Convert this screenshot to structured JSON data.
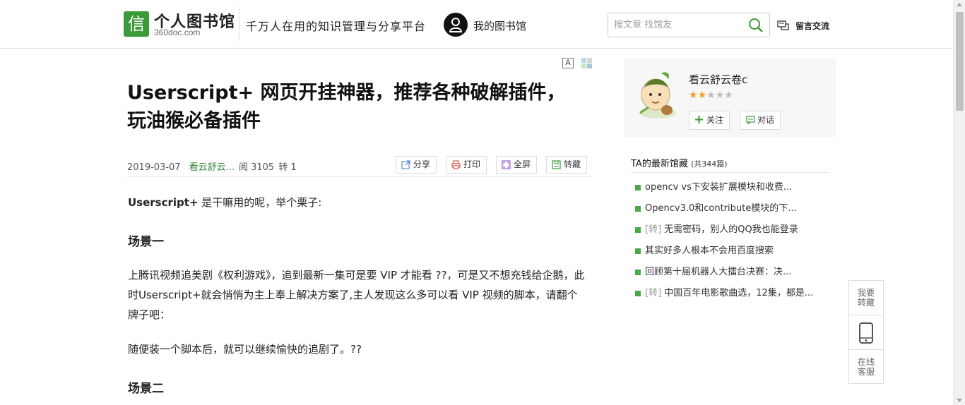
{
  "header": {
    "logo_glyph": "信",
    "logo_name": "个人图书馆",
    "logo_domain": "360doc.com",
    "slogan": "千万人在用的知识管理与分享平台",
    "my_library": "我的图书馆",
    "search_placeholder": "搜文章 找馆友",
    "message_label": "留言交流"
  },
  "article": {
    "font_toggle": "A",
    "title": "Userscript+ 网页开挂神器，推荐各种破解插件，玩油猴必备插件",
    "date": "2019-03-07",
    "author": "看云舒云...",
    "reads": "阅 3105",
    "reposts": "转 1",
    "actions": {
      "share": "分享",
      "print": "打印",
      "fullscreen": "全屏",
      "save": "转藏"
    },
    "intro_bold": "Userscript+",
    "intro_rest": " 是干嘛用的呢，举个栗子:",
    "heading1": "场景一",
    "para1": "上腾讯视频追美剧《权利游戏》，追到最新一集可是要 VIP 才能看 ??，可是又不想充钱给企鹅，此时Userscript+就会悄悄为主上奉上解决方案了,主人发现这么多可以看 VIP 视频的脚本，请翻个牌子吧：",
    "para2": "随便装一个脚本后，就可以继续愉快的追剧了。??",
    "heading2": "场景二"
  },
  "profile": {
    "name": "看云舒云卷c",
    "stars_filled": 2,
    "stars_total": 5,
    "follow": "关注",
    "chat": "对话"
  },
  "collection": {
    "heading": "TA的最新馆藏",
    "count": "(共344篇)",
    "items": [
      {
        "tag": "",
        "title": "opencv vs下安装扩展模块和收费..."
      },
      {
        "tag": "",
        "title": "Opencv3.0和contribute模块的下..."
      },
      {
        "tag": "[转]",
        "title": " 无需密码，别人的QQ我也能登录"
      },
      {
        "tag": "",
        "title": "其实好多人根本不会用百度搜索"
      },
      {
        "tag": "",
        "title": "回顾第十届机器人大擂台决赛：决..."
      },
      {
        "tag": "[转]",
        "title": " 中国百年电影歌曲选，12集，都是..."
      }
    ]
  },
  "float_tools": {
    "save": "我要转藏",
    "mobile_icon": "phone-icon",
    "service": "在线客服"
  },
  "colors": {
    "brand_green": "#3a9a3a",
    "star": "#f0a020"
  }
}
